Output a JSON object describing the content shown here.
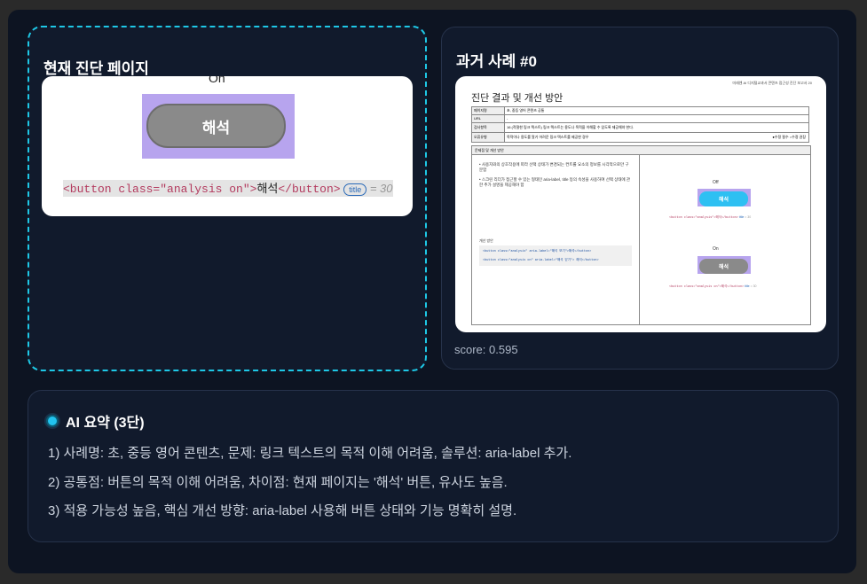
{
  "current": {
    "title": "현재 진단 페이지",
    "image": {
      "top_label": "On",
      "button_label": "해석",
      "code_prefix": "<button class=\"analysis on\">",
      "code_text": "해석",
      "code_suffix": "</button>",
      "badge": "title",
      "equals": "= 30"
    }
  },
  "past": {
    "title": "과거 사례 #0",
    "score": "score: 0.595",
    "doc": {
      "header_right": "미래엔 AI 디지털교과서 콘텐츠 접근성 진단 보고서  20",
      "title": "진단 결과 및 개선 방안",
      "rows": [
        {
          "label": "페이지명",
          "value": "초, 중등 영어 콘텐츠 공통"
        },
        {
          "label": "URL",
          "value": "-"
        },
        {
          "label": "검사항목",
          "value": "16 (적절한 링크 텍스트) 링크 텍스트는 용도나 목적을 이해할 수 있도록 제공해야 한다."
        },
        {
          "label": "오류유형",
          "value": "목적이나 용도를 알기 어려운 링크 텍스트를 제공한 경우",
          "extra": "●수정 필수   ○수정 권장"
        }
      ],
      "section_label": "문제점 및 개선 방안",
      "bullets": [
        "사용자와의 상호작용에 따라 선택 상태가 변경되는 컨트롤 요소의 정보를 시각적으로만 구분함",
        "스크린 리더가 접근할 수 있는 형태인 aria-label, title 등의 속성을 사용하여 선택 상태에 관한 추가 설명을 제공해야 함"
      ],
      "improve_label": "개선 방안",
      "code_lines": [
        "<button class=\"analysis\" aria-label=\"해석 보기\">해석</button>",
        "<button class=\"analysis on\" aria-label=\"해석 닫기\"> 해석</button>"
      ],
      "off_label": "Off",
      "off_button": "해석",
      "off_code": "<button class=\"analysis\">해석</button>",
      "on_label": "On",
      "on_button": "해석",
      "on_code": "<button class=\"analysis on\">해석</button>",
      "badge": "title",
      "equals": "= 30"
    }
  },
  "summary": {
    "title": "AI 요약 (3단)",
    "lines": [
      "1) 사례명: 초, 중등 영어 콘텐츠, 문제: 링크 텍스트의 목적 이해 어려움, 솔루션: aria-label 추가.",
      "2) 공통점: 버튼의 목적 이해 어려움, 차이점: 현재 페이지는 '해석' 버튼, 유사도 높음.",
      "3) 적용 가능성 높음, 핵심 개선 방향: aria-label 사용해 버튼 상태와 기능 명확히 설명."
    ]
  },
  "colors": {
    "accent": "#1ec8e6",
    "frame_bg": "#0d1422",
    "card_bg": "#111a2c",
    "button_gray": "#8a8a8a",
    "button_blue": "#2ec0f2",
    "highlight_purple": "#b7a4ee"
  }
}
